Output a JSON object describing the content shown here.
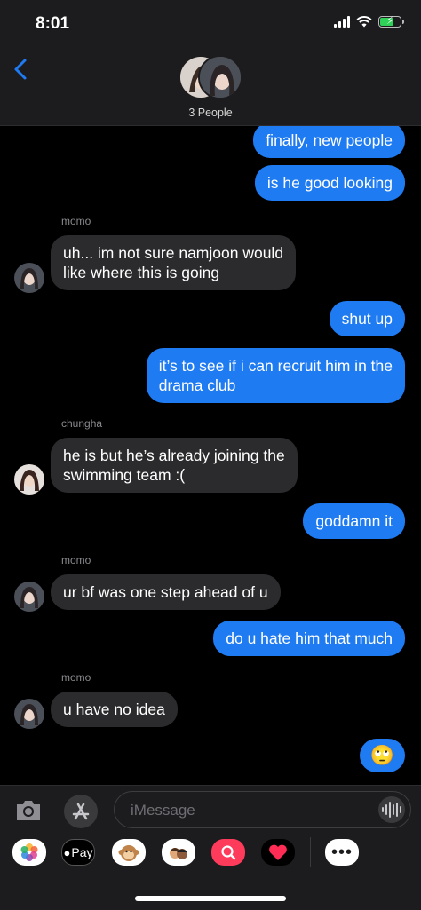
{
  "status": {
    "time": "8:01"
  },
  "header": {
    "group_label": "3 People"
  },
  "messages": [
    {
      "type": "sent",
      "text": "finally, new people"
    },
    {
      "type": "sent",
      "text": "is he good looking"
    },
    {
      "type": "label",
      "text": "momo"
    },
    {
      "type": "recv",
      "lines": [
        "uh... im not sure namjoon would",
        "like where this is going"
      ]
    },
    {
      "type": "sent",
      "text": "shut up"
    },
    {
      "type": "sent",
      "lines": [
        "it’s to see if i can recruit him in the",
        "drama club"
      ]
    },
    {
      "type": "label",
      "text": "chungha"
    },
    {
      "type": "recv",
      "lines": [
        "he is but he’s already joining the",
        "swimming team :("
      ]
    },
    {
      "type": "sent",
      "text": "goddamn it"
    },
    {
      "type": "label",
      "text": "momo"
    },
    {
      "type": "recv",
      "text": "ur bf was one step ahead of u"
    },
    {
      "type": "sent",
      "text": "do u hate him that much"
    },
    {
      "type": "label",
      "text": "momo"
    },
    {
      "type": "recv",
      "text": "u have no idea"
    },
    {
      "type": "sent",
      "text": "🙄"
    }
  ],
  "composer": {
    "placeholder": "iMessage"
  },
  "apps": [
    {
      "name": "photos-app-icon"
    },
    {
      "name": "apple-pay-app",
      "label": "Pay"
    },
    {
      "name": "animoji-app-icon"
    },
    {
      "name": "memoji-app-icon"
    },
    {
      "name": "search-images-app-icon"
    },
    {
      "name": "digital-touch-app-icon"
    },
    {
      "name": "more-apps-icon"
    }
  ],
  "colors": {
    "sent": "#1f7bf1",
    "received": "#2b2b2d",
    "background": "#000000",
    "bar": "#1c1c1e"
  }
}
